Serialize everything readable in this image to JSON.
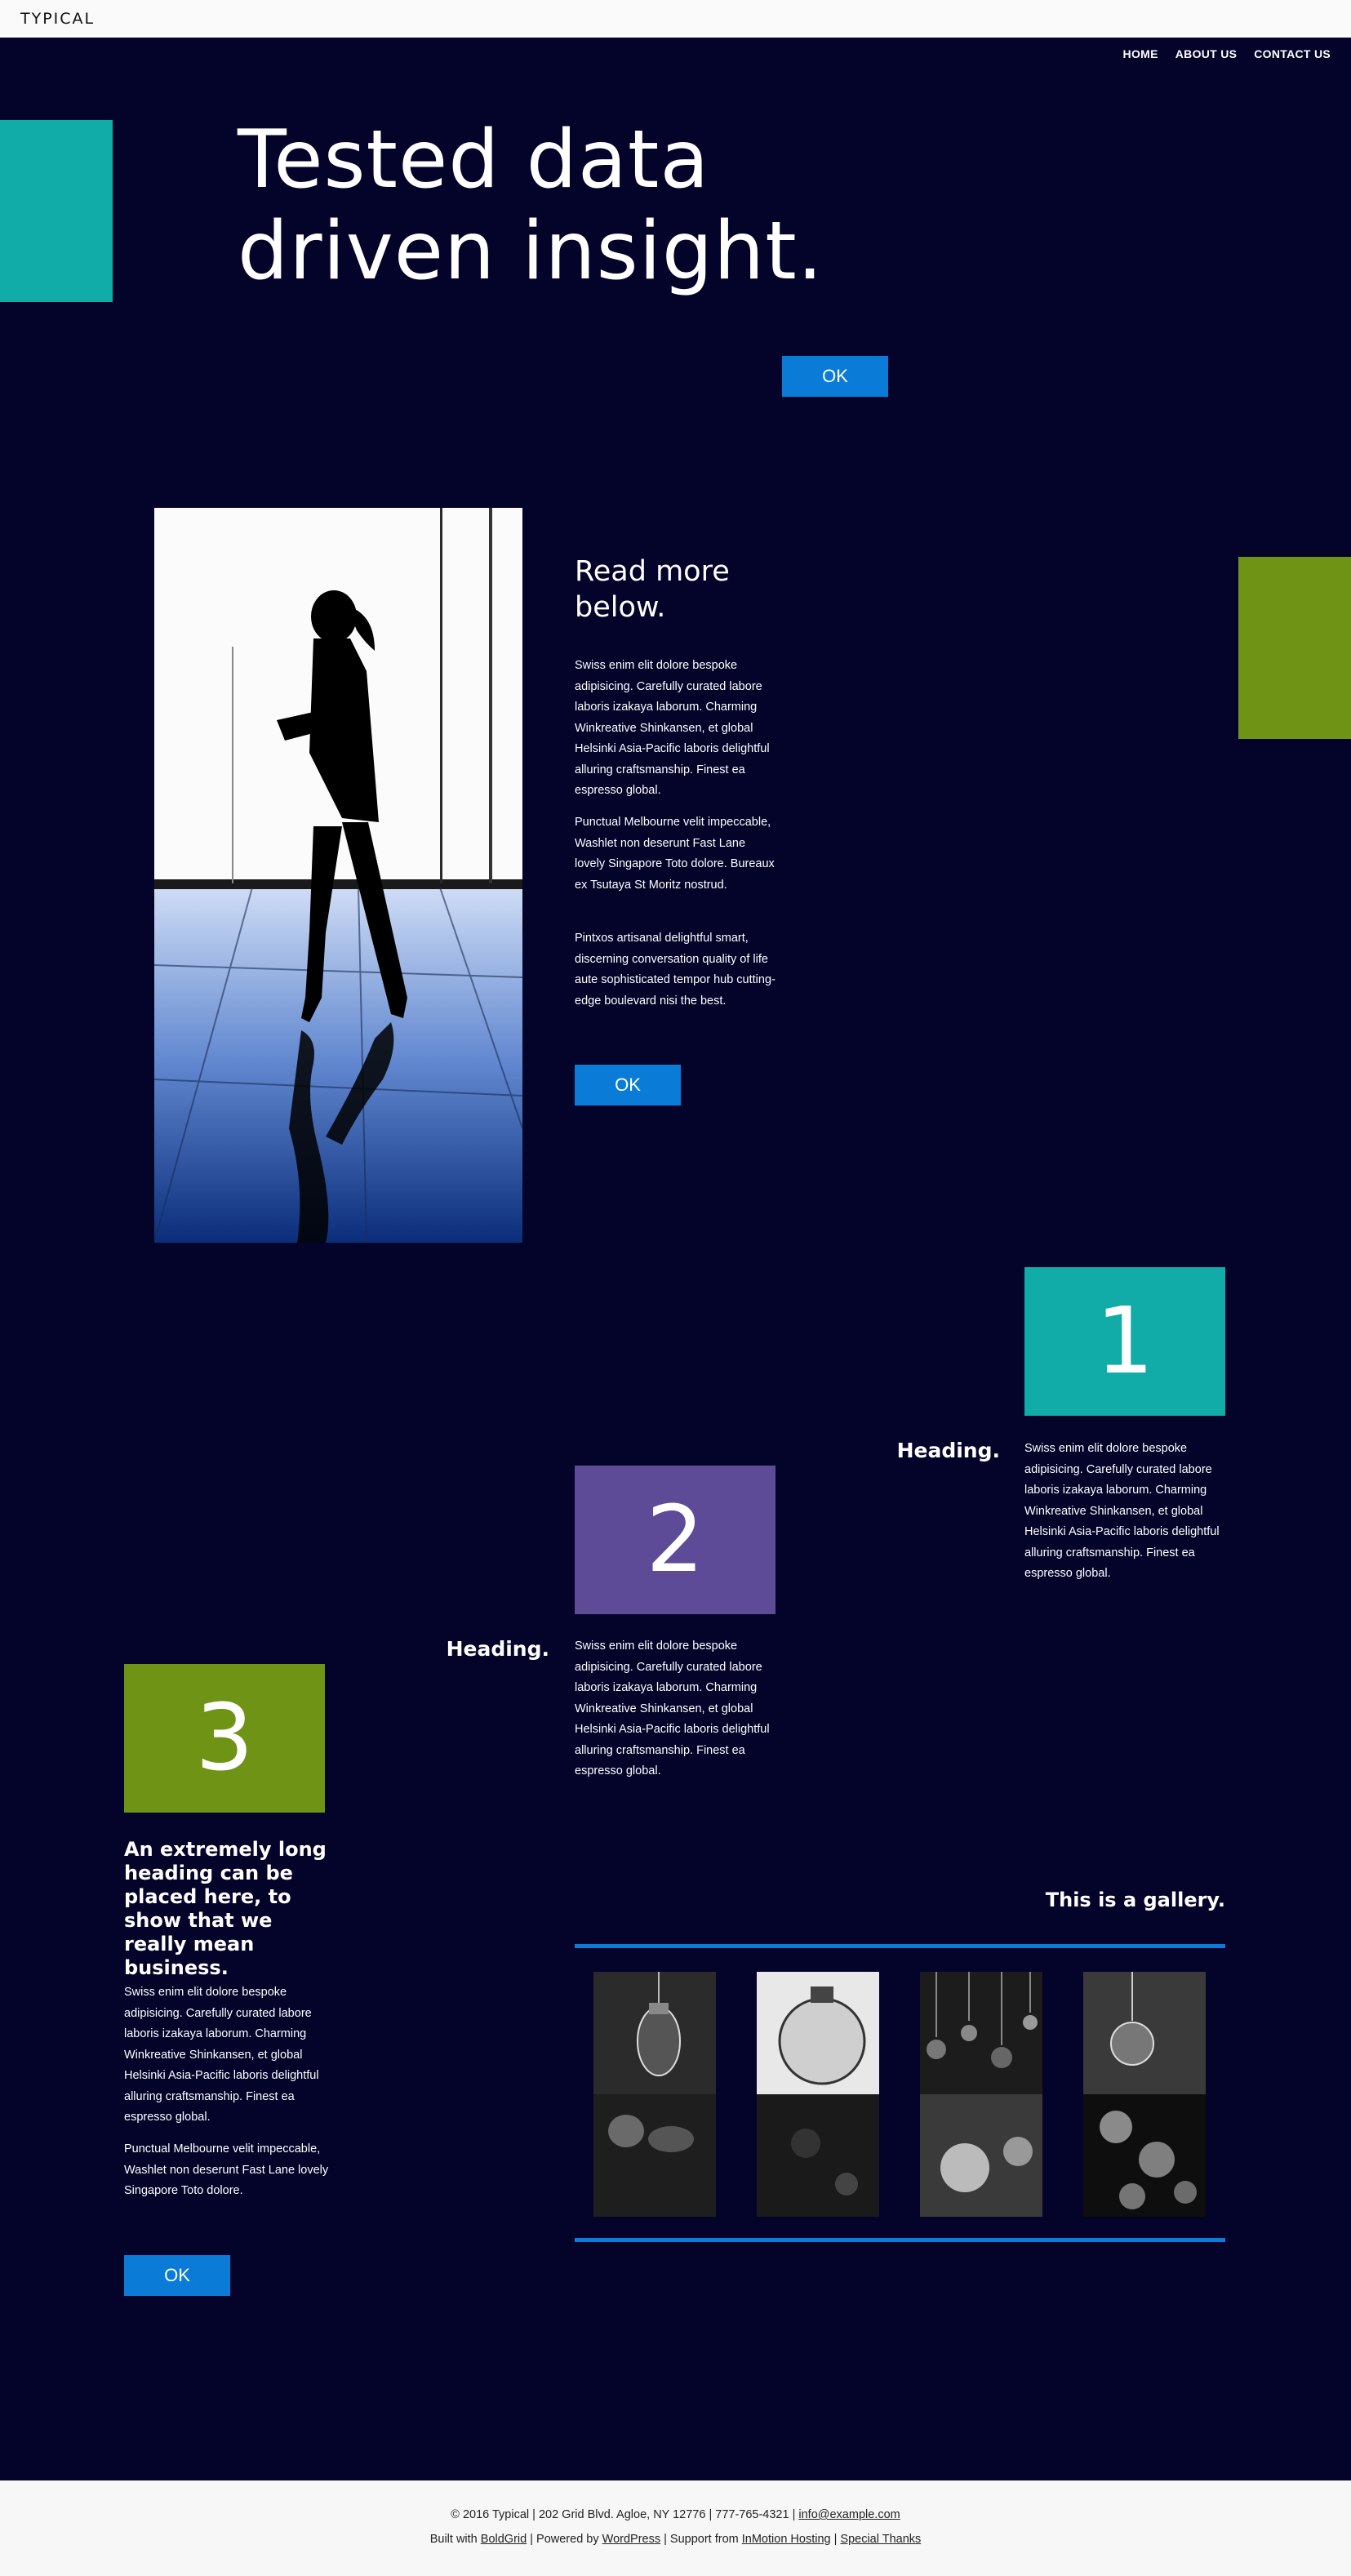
{
  "header": {
    "brand": "TYPICAL"
  },
  "nav": {
    "items": [
      "HOME",
      "ABOUT US",
      "CONTACT US"
    ]
  },
  "hero": {
    "title_line1": "Tested data",
    "title_line2": "driven insight.",
    "button": "OK"
  },
  "feature": {
    "title_line1": "Read more",
    "title_line2": "below.",
    "paragraphs": [
      "Swiss enim elit dolore bespoke adipisicing. Carefully curated labore laboris izakaya laborum. Charming Winkreative Shinkansen, et global Helsinki Asia-Pacific laboris delightful alluring craftsmanship. Finest ea espresso global.",
      "Punctual Melbourne velit impeccable, Washlet non deserunt Fast Lane lovely Singapore Toto dolore. Bureaux ex Tsutaya St Moritz nostrud.",
      "Pintxos artisanal delightful smart, discerning conversation quality of life aute sophisticated tempor hub cutting-edge boulevard nisi the best."
    ],
    "button": "OK"
  },
  "steps": [
    {
      "number": "1",
      "heading": "Heading.",
      "text": "Swiss enim elit dolore bespoke adipisicing. Carefully curated labore laboris izakaya laborum. Charming Winkreative Shinkansen, et global Helsinki Asia-Pacific laboris delightful alluring craftsmanship. Finest ea espresso global.",
      "color": "#11aca8"
    },
    {
      "number": "2",
      "heading": "Heading.",
      "text": "Swiss enim elit dolore bespoke adipisicing. Carefully curated labore laboris izakaya laborum. Charming Winkreative Shinkansen, et global Helsinki Asia-Pacific laboris delightful alluring craftsmanship. Finest ea espresso global.",
      "color": "#5e4b98"
    },
    {
      "number": "3",
      "color": "#6f9314"
    }
  ],
  "long_section": {
    "heading": "An extremely long heading can be placed here, to show that we really mean business.",
    "paragraphs": [
      "Swiss enim elit dolore bespoke adipisicing. Carefully curated labore laboris izakaya laborum. Charming Winkreative Shinkansen, et global Helsinki Asia-Pacific laboris delightful alluring craftsmanship. Finest ea espresso global.",
      "Punctual Melbourne velit impeccable, Washlet non deserunt Fast Lane lovely Singapore Toto dolore."
    ],
    "button": "OK"
  },
  "gallery": {
    "title": "This is a gallery."
  },
  "footer": {
    "line1_text": "© 2016 Typical | 202 Grid Blvd. Agloe, NY 12776 | 777-765-4321 | ",
    "line1_email": "info@example.com",
    "line2_prefix": "Built with ",
    "line2_boldgrid": "BoldGrid",
    "line2_mid1": " | Powered by ",
    "line2_wordpress": "WordPress",
    "line2_mid2": " | Support from ",
    "line2_inmotion": "InMotion Hosting",
    "line2_mid3": " | ",
    "line2_thanks": "Special Thanks"
  },
  "colors": {
    "background": "#04032a",
    "accent_teal": "#11aca8",
    "accent_green": "#6f9314",
    "accent_purple": "#5e4b98",
    "button_blue": "#0a7bd6"
  }
}
